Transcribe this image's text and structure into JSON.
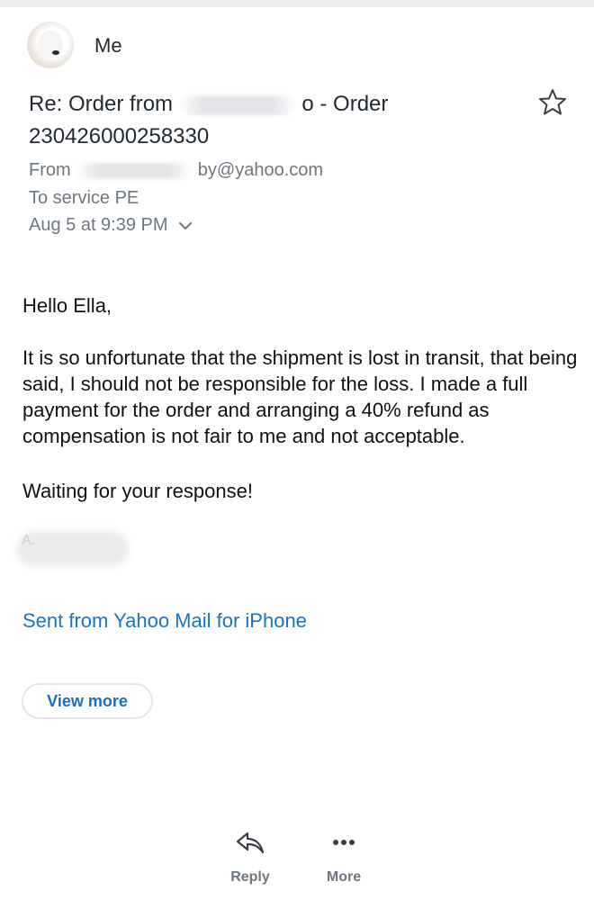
{
  "header": {
    "sender_name": "Me",
    "subject_line1_start": "Re: Order from",
    "subject_line1_end": "o - Order",
    "subject_line2": "230426000258330",
    "from_prefix": "From",
    "from_suffix": "by@yahoo.com",
    "to_line": "To service PE",
    "date": "Aug 5 at 9:39 PM",
    "icons": {
      "star": "star-icon",
      "expand": "chevron-down-icon",
      "avatar": "avatar"
    }
  },
  "message": {
    "greeting": "Hello Ella,",
    "paragraph": "It is so unfortunate that the shipment is lost in transit, that being said, I should not be responsible for the loss. I made a full payment for the order and arranging a 40% refund as compensation is not fair to me and not acceptable.",
    "closing": "Waiting for your response!",
    "signature_link": "Sent from Yahoo Mail for iPhone"
  },
  "actions": {
    "view_more": "View more",
    "reply": "Reply",
    "more": "More",
    "reply_icon": "reply-icon",
    "more_icon": "more-dots-icon"
  },
  "colors": {
    "link": "#1a73c8",
    "meta_text": "#6e7780",
    "body_text": "#111111"
  }
}
